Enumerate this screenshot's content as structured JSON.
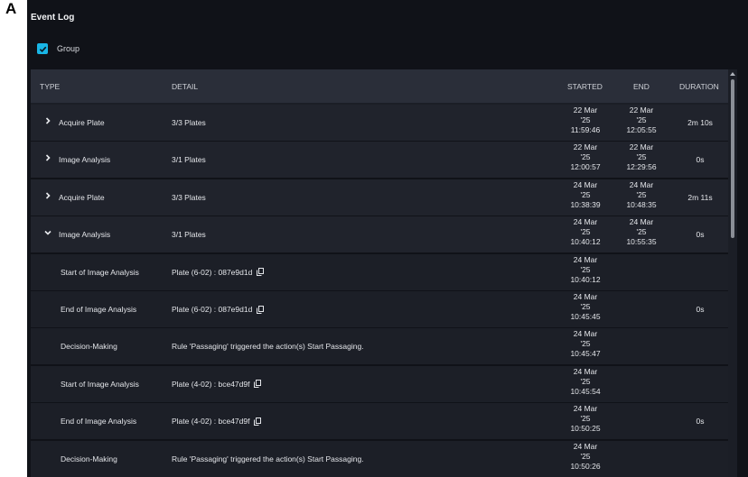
{
  "panel_letter": "A",
  "title": "Event Log",
  "group_checkbox": {
    "label": "Group",
    "checked": true
  },
  "columns": {
    "type": "TYPE",
    "detail": "DETAIL",
    "started": "STARTED",
    "end": "END",
    "duration": "DURATION"
  },
  "rows": [
    {
      "type": "Acquire Plate",
      "detail": "3/3 Plates",
      "started": [
        "22 Mar",
        "'25",
        "11:59:46"
      ],
      "end": [
        "22 Mar",
        "'25",
        "12:05:55"
      ],
      "duration": "2m 10s",
      "expandable": true,
      "expanded": false,
      "child": false,
      "copy": false
    },
    {
      "type": "Image Analysis",
      "detail": "3/1 Plates",
      "started": [
        "22 Mar",
        "'25",
        "12:00:57"
      ],
      "end": [
        "22 Mar",
        "'25",
        "12:29:56"
      ],
      "duration": "0s",
      "expandable": true,
      "expanded": false,
      "child": false,
      "copy": false
    },
    {
      "type": "Acquire Plate",
      "detail": "3/3 Plates",
      "started": [
        "24 Mar",
        "'25",
        "10:38:39"
      ],
      "end": [
        "24 Mar",
        "'25",
        "10:48:35"
      ],
      "duration": "2m 11s",
      "expandable": true,
      "expanded": false,
      "child": false,
      "copy": false
    },
    {
      "type": "Image Analysis",
      "detail": "3/1 Plates",
      "started": [
        "24 Mar",
        "'25",
        "10:40:12"
      ],
      "end": [
        "24 Mar",
        "'25",
        "10:55:35"
      ],
      "duration": "0s",
      "expandable": true,
      "expanded": true,
      "child": false,
      "copy": false
    },
    {
      "type": "Start of Image Analysis",
      "detail": "Plate (6-02) : 087e9d1d",
      "started": [
        "24 Mar",
        "'25",
        "10:40:12"
      ],
      "end": [],
      "duration": "",
      "expandable": false,
      "expanded": false,
      "child": true,
      "copy": true
    },
    {
      "type": "End of Image Analysis",
      "detail": "Plate (6-02) : 087e9d1d",
      "started": [
        "24 Mar",
        "'25",
        "10:45:45"
      ],
      "end": [],
      "duration": "0s",
      "expandable": false,
      "expanded": false,
      "child": true,
      "copy": true
    },
    {
      "type": "Decision-Making",
      "detail": "Rule 'Passaging' triggered the action(s) Start Passaging.",
      "started": [
        "24 Mar",
        "'25",
        "10:45:47"
      ],
      "end": [],
      "duration": "",
      "expandable": false,
      "expanded": false,
      "child": true,
      "copy": false
    },
    {
      "type": "Start of Image Analysis",
      "detail": "Plate (4-02) : bce47d9f",
      "started": [
        "24 Mar",
        "'25",
        "10:45:54"
      ],
      "end": [],
      "duration": "",
      "expandable": false,
      "expanded": false,
      "child": true,
      "copy": true
    },
    {
      "type": "End of Image Analysis",
      "detail": "Plate (4-02) : bce47d9f",
      "started": [
        "24 Mar",
        "'25",
        "10:50:25"
      ],
      "end": [],
      "duration": "0s",
      "expandable": false,
      "expanded": false,
      "child": true,
      "copy": true
    },
    {
      "type": "Decision-Making",
      "detail": "Rule 'Passaging' triggered the action(s) Start Passaging.",
      "started": [
        "24 Mar",
        "'25",
        "10:50:26"
      ],
      "end": [],
      "duration": "",
      "expandable": false,
      "expanded": false,
      "child": true,
      "copy": false
    }
  ],
  "colors": {
    "background": "#101218",
    "header": "#2a2e39",
    "row": "#20232c",
    "checkbox": "#19b6e6"
  }
}
